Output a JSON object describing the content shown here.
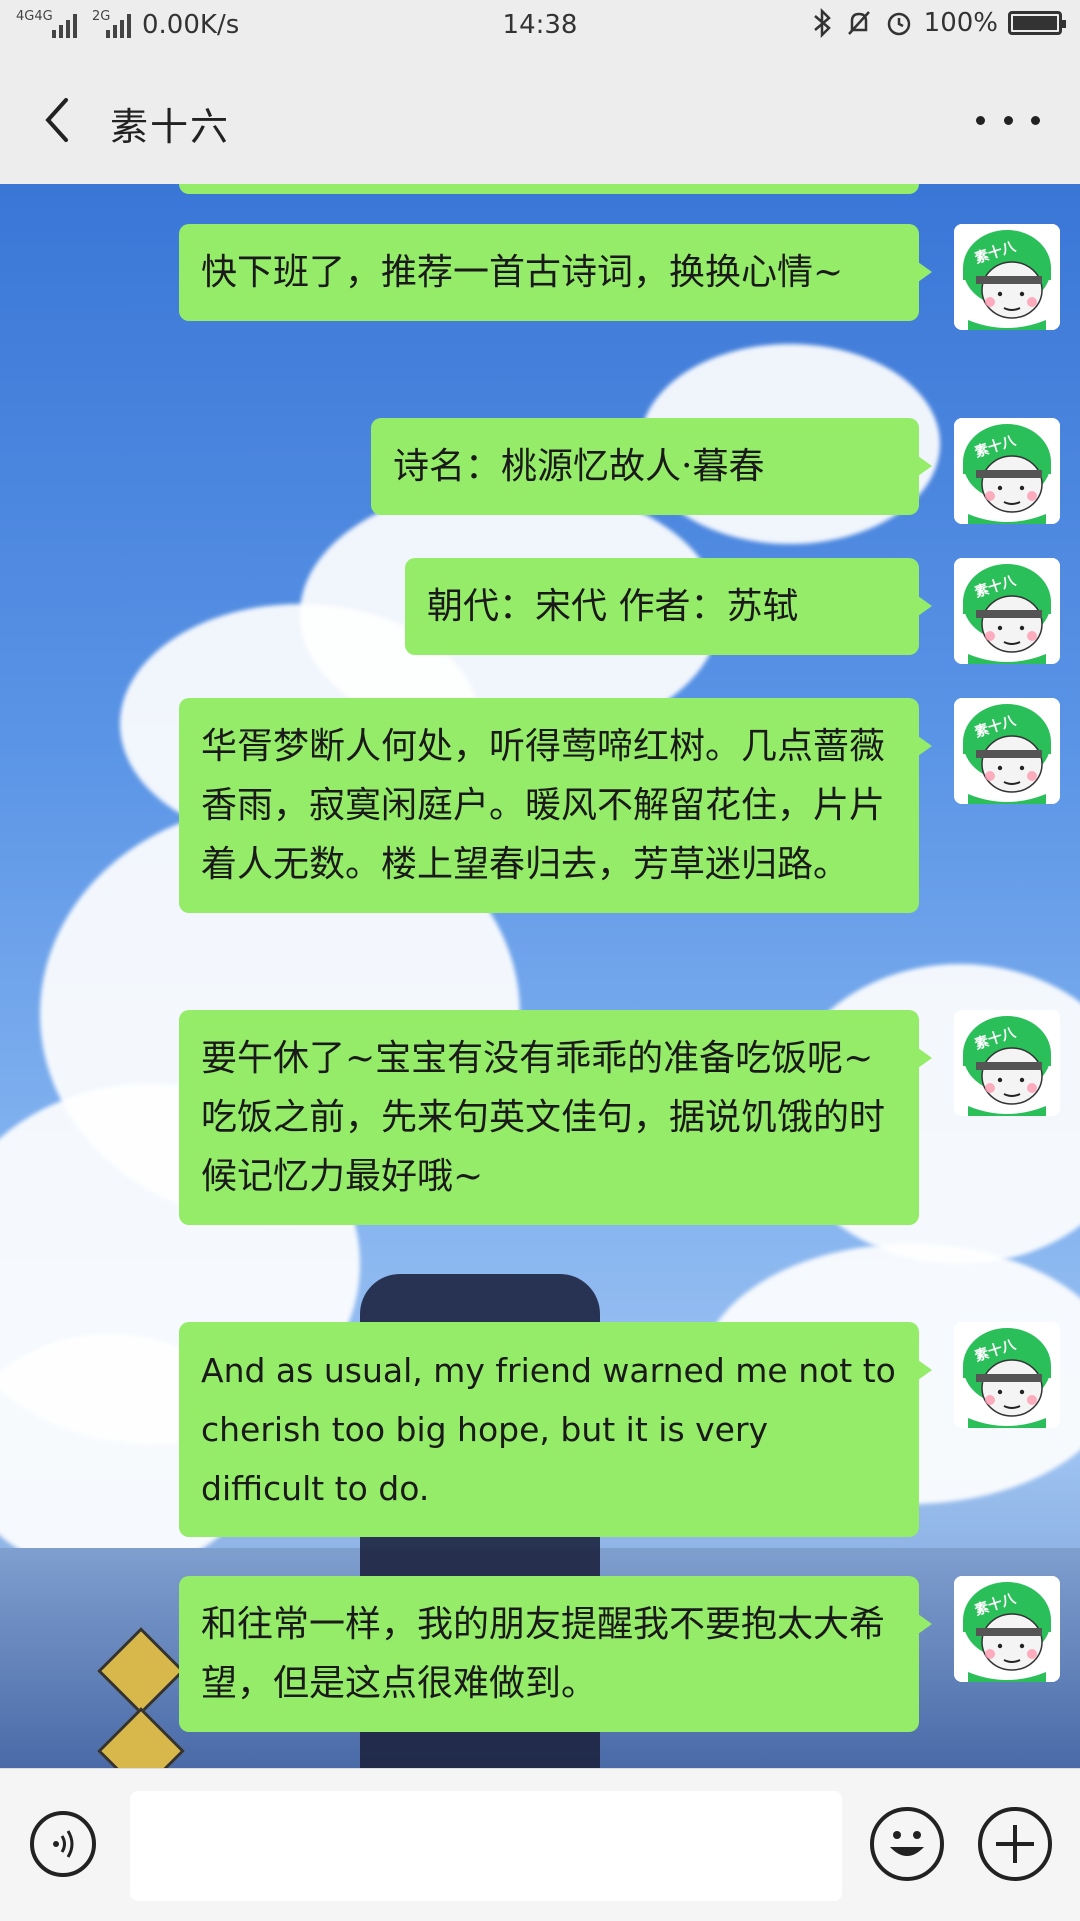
{
  "status_bar": {
    "network_1": "4G",
    "network_2": "4G",
    "network_3": "2G",
    "speed": "0.00K/s",
    "time": "14:38",
    "battery": "100%",
    "battery_level": 1.0
  },
  "header": {
    "title": "素十六"
  },
  "messages": [
    {
      "text": "快下班了，推荐一首古诗词，换换心情~"
    },
    {
      "text": "诗名：桃源忆故人·暮春"
    },
    {
      "text": "朝代：宋代 作者：苏轼"
    },
    {
      "text": "华胥梦断人何处，听得莺啼红树。几点蔷薇香雨，寂寞闲庭户。暖风不解留花住，片片着人无数。楼上望春归去，芳草迷归路。"
    },
    {
      "text": "要午休了~宝宝有没有乖乖的准备吃饭呢~吃饭之前，先来句英文佳句，据说饥饿的时候记忆力最好哦~"
    },
    {
      "text": "And as usual, my friend warned me not to cherish too big hope, but it is very difficult to do."
    },
    {
      "text": "和往常一样，我的朋友提醒我不要抱太大希望，但是这点很难做到。"
    }
  ],
  "avatar": {
    "label": "素十八"
  },
  "composer": {
    "voice_icon": "voice-icon",
    "emoji_icon": "emoji-icon",
    "plus_icon": "plus-icon",
    "input_value": ""
  },
  "colors": {
    "bubble": "#95ec69",
    "bar_bg": "#ededed",
    "avatar_green": "#2bbf5a"
  }
}
